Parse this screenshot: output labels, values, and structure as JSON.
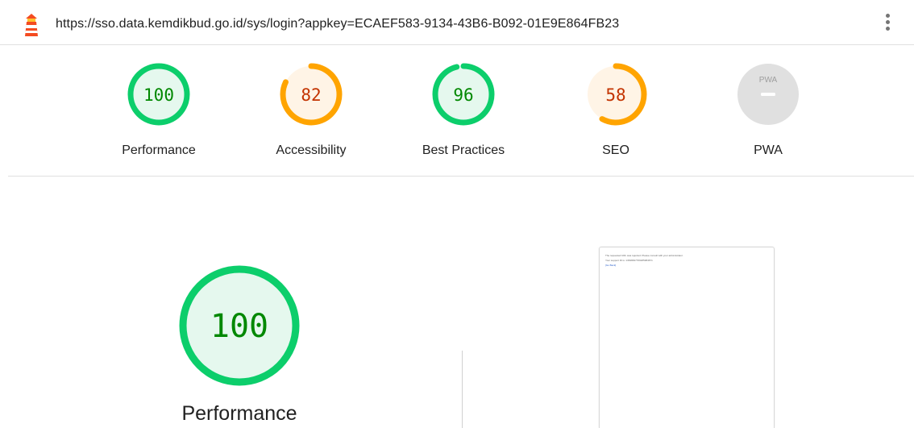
{
  "topbar": {
    "url": "https://sso.data.kemdikbud.go.id/sys/login?appkey=ECAEF583-9134-43B6-B092-01E9E864FB23",
    "logo_icon": "lighthouse-icon",
    "menu_icon": "more-vert-icon"
  },
  "colors": {
    "pass": "#0cce6b",
    "pass_text": "#008800",
    "pass_fill": "#e5f8ee",
    "average": "#ffa400",
    "average_text": "#c33300",
    "average_fill": "#fff4e6",
    "pwa_fill": "#e0e0e0",
    "pwa_text": "#9e9e9e"
  },
  "scores": [
    {
      "label": "Performance",
      "score": "100",
      "value": 100
    },
    {
      "label": "Accessibility",
      "score": "82",
      "value": 82
    },
    {
      "label": "Best Practices",
      "score": "96",
      "value": 96
    },
    {
      "label": "SEO",
      "score": "58",
      "value": 58
    },
    {
      "label": "PWA",
      "score": "PWA",
      "value": null
    }
  ],
  "main": {
    "score": "100",
    "value": 100,
    "label": "Performance"
  },
  "screenshot": {
    "line1": "The requested URL was rejected. Please consult with your administrator.",
    "line2": "Your support ID is: 13638497769185384671",
    "line3": "[Go Back]"
  }
}
